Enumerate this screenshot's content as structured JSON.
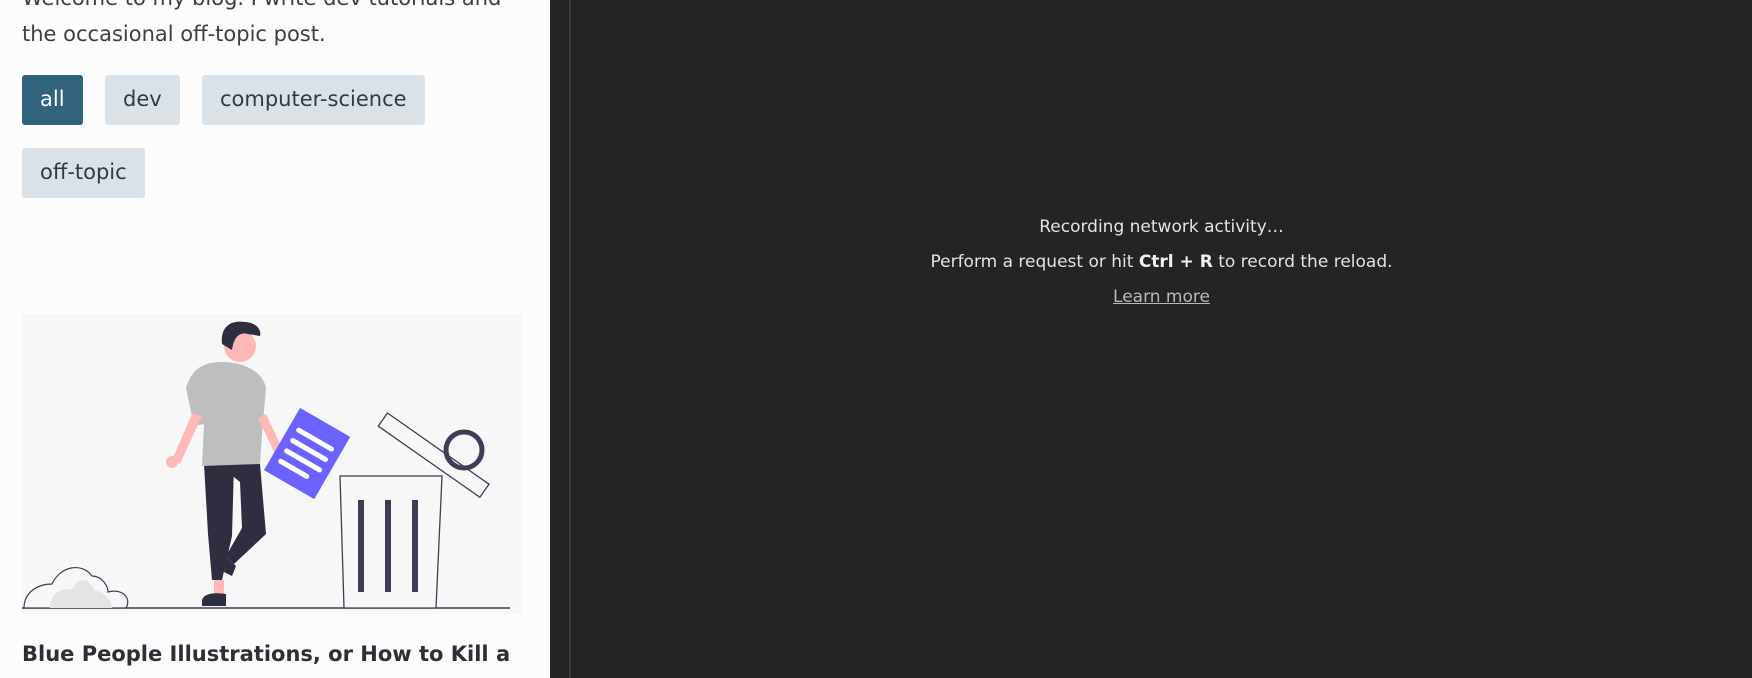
{
  "blog": {
    "intro_text": "Welcome to my blog. I write dev tutorials and the occasional off-topic post.",
    "tags": [
      {
        "label": "all",
        "active": true
      },
      {
        "label": "dev",
        "active": false
      },
      {
        "label": "computer-science",
        "active": false
      },
      {
        "label": "off-topic",
        "active": false
      }
    ],
    "post_title": "Blue People Illustrations, or How to Kill a Brand"
  },
  "devtools": {
    "status_line": "Recording network activity…",
    "hint_prefix": "Perform a request or hit ",
    "hint_shortcut": "Ctrl + R",
    "hint_suffix": " to record the reload.",
    "learn_more": "Learn more"
  },
  "colors": {
    "tag_active_bg": "#32637d",
    "tag_bg": "#dae1e7",
    "devtools_bg": "#242424",
    "illustration_accent": "#6c63ff"
  }
}
